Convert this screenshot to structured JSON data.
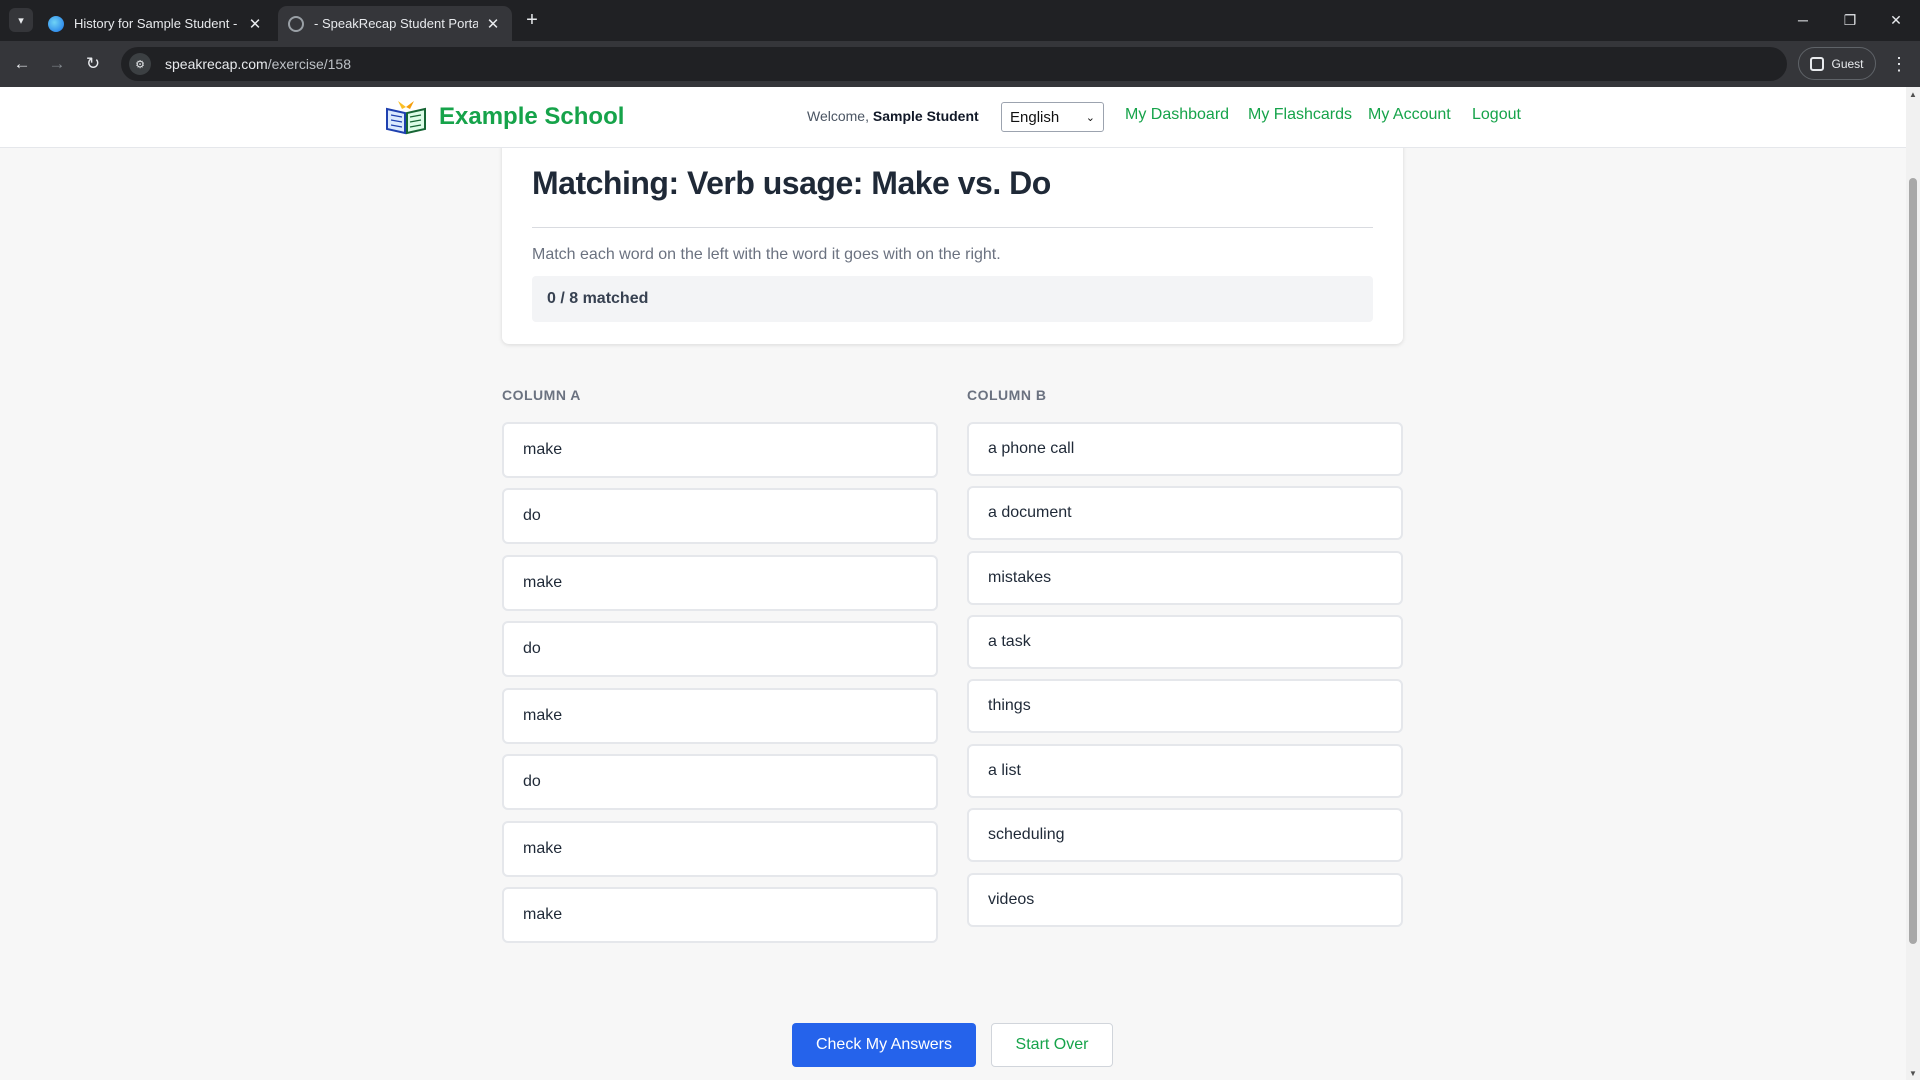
{
  "browser": {
    "tabs": [
      {
        "title": "History for Sample Student - SpeakRecap",
        "active": false
      },
      {
        "title": "- SpeakRecap Student Portal",
        "active": true
      }
    ],
    "url_host": "speakrecap.com",
    "url_path": "/exercise/158",
    "profile_label": "Guest"
  },
  "header": {
    "brand": "Example School",
    "welcome_prefix": "Welcome,",
    "user_name": "Sample Student",
    "language": "English",
    "nav": [
      "My Dashboard",
      "My Flashcards",
      "My Account",
      "Logout"
    ]
  },
  "exercise": {
    "title": "Matching: Verb usage: Make vs. Do",
    "instructions": "Match each word on the left with the word it goes with on the right.",
    "progress": "0 / 8 matched",
    "column_a_heading": "COLUMN A",
    "column_b_heading": "COLUMN B",
    "column_a": [
      "make",
      "do",
      "make",
      "do",
      "make",
      "do",
      "make",
      "make"
    ],
    "column_b": [
      "a phone call",
      "a document",
      "mistakes",
      "a task",
      "things",
      "a list",
      "scheduling",
      "videos"
    ]
  },
  "actions": {
    "check": "Check My Answers",
    "reset": "Start Over"
  },
  "colors": {
    "brand_green": "#16a34a",
    "primary_blue": "#2563eb"
  }
}
